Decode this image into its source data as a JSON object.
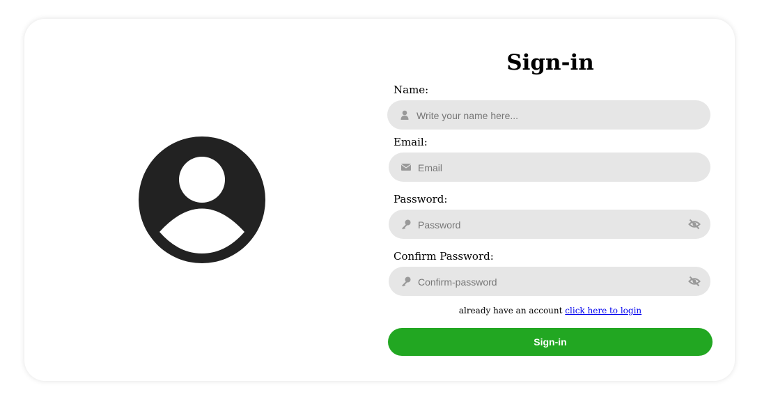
{
  "form": {
    "title": "Sign-in",
    "fields": [
      {
        "label": "Name:",
        "placeholder": "Write your name here...",
        "value": "",
        "icon": "user-icon"
      },
      {
        "label": "Email:",
        "placeholder": "Email",
        "value": "",
        "icon": "envelope-icon"
      },
      {
        "label": "Password:",
        "placeholder": "Password",
        "value": "",
        "icon": "key-icon",
        "toggle_icon": "eye-slash-icon"
      },
      {
        "label": "Confirm Password:",
        "placeholder": "Confirm-password",
        "value": "",
        "icon": "key-icon",
        "toggle_icon": "eye-slash-icon"
      }
    ],
    "account_text": "already have an account",
    "login_link": "click here to login",
    "submit_label": "Sign-in"
  },
  "colors": {
    "accent": "#22a722",
    "field_bg": "#e6e6e6",
    "avatar": "#222222"
  },
  "avatar_icon": "user-circle-icon"
}
